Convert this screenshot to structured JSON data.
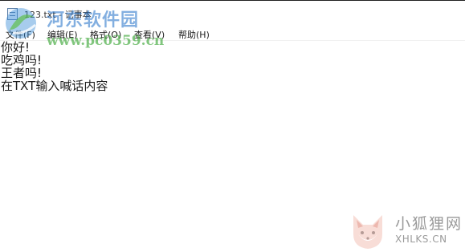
{
  "window": {
    "title": "123.txt - 记事本"
  },
  "menu": {
    "items": [
      {
        "label": "文件(F)"
      },
      {
        "label": "编辑(E)"
      },
      {
        "label": "格式(O)"
      },
      {
        "label": "查看(V)"
      },
      {
        "label": "帮助(H)"
      }
    ]
  },
  "editor": {
    "lines": [
      "你好!",
      "吃鸡吗!",
      "王者吗!",
      "在TXT输入喊话内容"
    ]
  },
  "watermarks": {
    "top_left": {
      "title": "河东软件园",
      "url": "www.pc0359.cn",
      "color": "#1f6fc8",
      "url_color": "#3fa83a"
    },
    "bottom_right": {
      "title": "小狐狸网",
      "url": "XHLKS.CN",
      "icon": "fox-logo-icon",
      "color": "#e8a29a"
    }
  }
}
